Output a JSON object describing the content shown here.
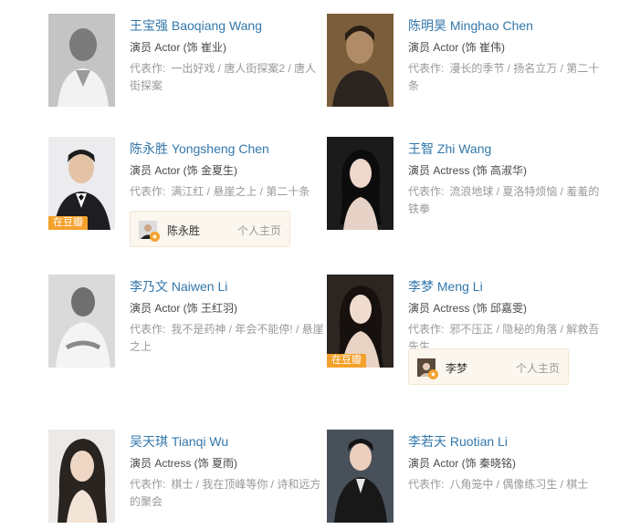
{
  "cast": [
    {
      "name": "王宝强 Baoqiang Wang",
      "role": "演员 Actor (饰 崔业)",
      "works_label": "代表作:",
      "works": "一出好戏 / 唐人街探案2 / 唐人街探案",
      "photo_bg": "#b9b9b9",
      "grayscale": true
    },
    {
      "name": "陈明昊 Minghao Chen",
      "role": "演员 Actor (饰 崔伟)",
      "works_label": "代表作:",
      "works": "漫长的季节 / 扬名立万 / 第二十条",
      "photo_bg": "#6b5236"
    },
    {
      "name": "陈永胜 Yongsheng Chen",
      "role": "演员 Actor (饰 金夏生)",
      "works_label": "代表作:",
      "works": "满江红 / 悬崖之上 / 第二十条",
      "photo_bg": "#e9e9ec",
      "badge": "在豆瓣",
      "homepage": {
        "name": "陈永胜",
        "link": "个人主页"
      }
    },
    {
      "name": "王智 Zhi Wang",
      "role": "演员 Actress (饰 高淑华)",
      "works_label": "代表作:",
      "works": "流浪地球 / 夏洛特烦恼 / 羞羞的铁拳",
      "photo_bg": "#1e1e1e"
    },
    {
      "name": "李乃文 Naiwen Li",
      "role": "演员 Actor (饰 王红羽)",
      "works_label": "代表作:",
      "works": "我不是药神 / 年会不能停! / 悬崖之上",
      "photo_bg": "#d6d6d6",
      "grayscale": true
    },
    {
      "name": "李梦 Meng Li",
      "role": "演员 Actress (饰 邱嘉雯)",
      "works_label": "代表作:",
      "works": "邪不压正 / 隐秘的角落 / 解救吾先生",
      "photo_bg": "#2a2420",
      "badge": "在豆瓣",
      "homepage": {
        "name": "李梦",
        "link": "个人主页"
      }
    },
    {
      "name": "吴天琪 Tianqi Wu",
      "role": "演员 Actress (饰 夏雨)",
      "works_label": "代表作:",
      "works": "棋士 / 我在顶峰等你 / 诗和远方的聚会",
      "photo_bg": "#e8e6e3"
    },
    {
      "name": "李若天 Ruotian Li",
      "role": "演员 Actor (饰 秦晓铭)",
      "works_label": "代表作:",
      "works": "八角笼中 / 偶像练习生 / 棋士",
      "photo_bg": "#3f4650"
    }
  ]
}
